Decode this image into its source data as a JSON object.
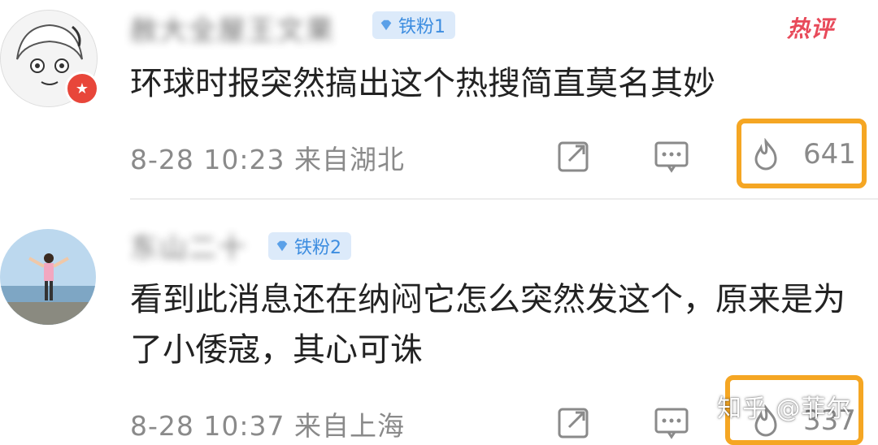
{
  "comments": [
    {
      "username": "赦大全屋王文果",
      "fan_badge": "铁粉1",
      "hot_label": "热评",
      "text": "环球时报突然搞出这个热搜简直莫名其妙",
      "date": "8-28 10:23",
      "location": "来自湖北",
      "likes": "641"
    },
    {
      "username": "东山二十",
      "fan_badge": "铁粉2",
      "text": "看到此消息还在纳闷它怎么突然发这个，原来是为了小倭寇，其心可诛",
      "date": "8-28 10:37",
      "location": "来自上海",
      "likes": "337"
    }
  ],
  "watermark": "知乎 @菲尔",
  "colors": {
    "highlight_box": "#f5a623",
    "fan_badge_bg": "#dceafa",
    "fan_badge_text": "#3d8de0",
    "hot_label": "#e84a5a",
    "meta_gray": "#8a8a8a"
  }
}
